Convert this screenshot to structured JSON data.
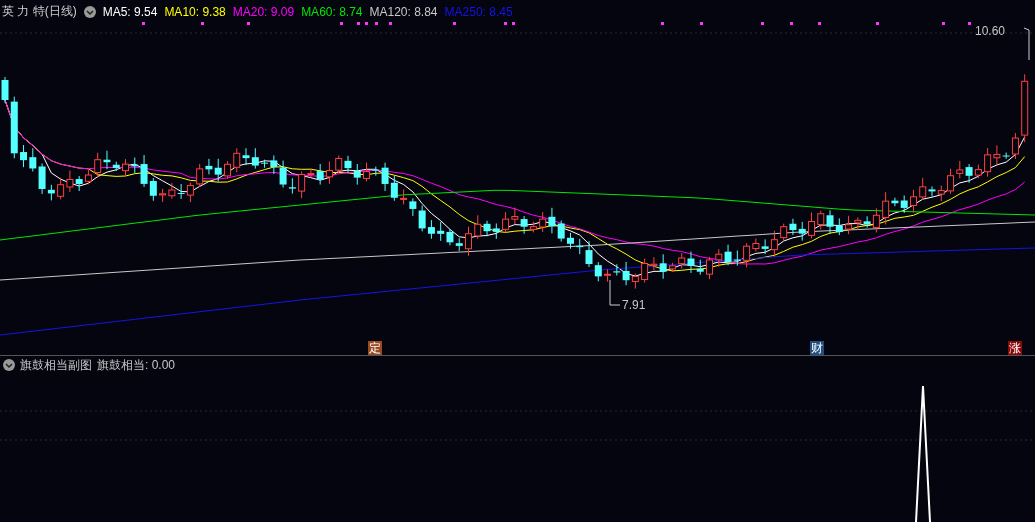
{
  "header": {
    "title": "英 力 特(日线)",
    "legend": [
      {
        "label": "MA5: 9.54",
        "color": "#ffffff"
      },
      {
        "label": "MA10: 9.38",
        "color": "#ffff00"
      },
      {
        "label": "MA20: 9.09",
        "color": "#ff00ff"
      },
      {
        "label": "MA60: 8.74",
        "color": "#00e600"
      },
      {
        "label": "MA120: 8.84",
        "color": "#c8c8c8"
      },
      {
        "label": "MA250: 8.45",
        "color": "#1414e6"
      }
    ]
  },
  "price_labels": {
    "high": "10.60",
    "low": "7.91"
  },
  "event_markers": [
    {
      "text": "定",
      "color": "#9a4a22"
    },
    {
      "text": "财",
      "color": "#1f4f80"
    },
    {
      "text": "涨",
      "color": "#8a0a0a"
    }
  ],
  "sub_chart": {
    "title": "旗鼓相当副图",
    "indicator": "旗鼓相当: 0.00"
  }
}
